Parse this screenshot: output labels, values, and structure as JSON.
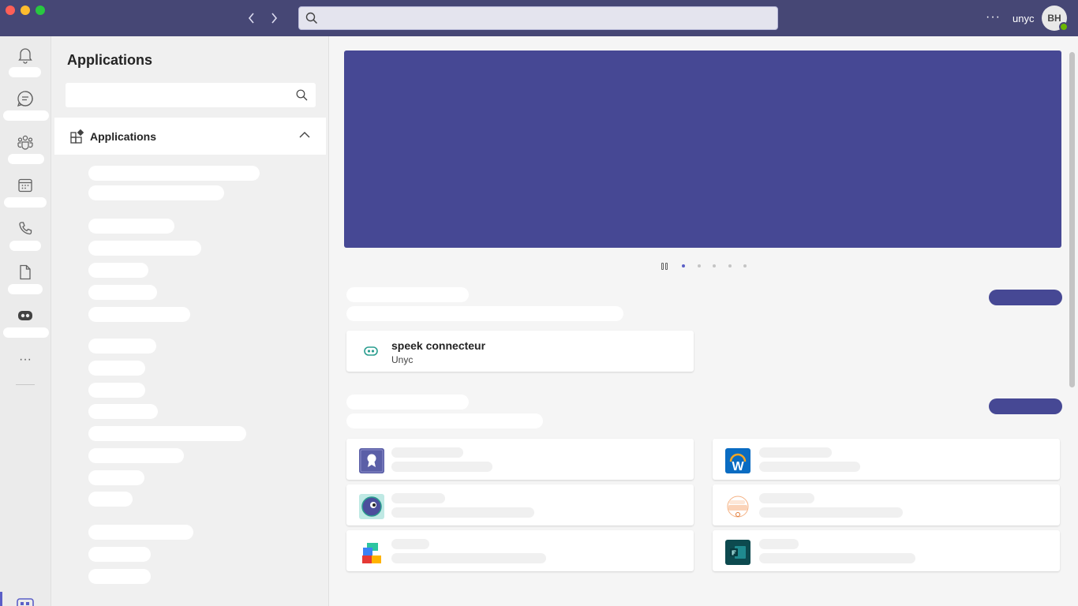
{
  "titlebar": {
    "search_placeholder": "",
    "org_name": "unyc",
    "avatar_initials": "BH",
    "more_label": "···"
  },
  "rail": {
    "items": [
      {
        "icon": "bell-icon"
      },
      {
        "icon": "chat-icon"
      },
      {
        "icon": "teams-icon"
      },
      {
        "icon": "calendar-icon"
      },
      {
        "icon": "phone-icon"
      },
      {
        "icon": "file-icon"
      },
      {
        "icon": "bot-icon"
      },
      {
        "icon": "more-icon"
      }
    ],
    "more_label": "···"
  },
  "panel": {
    "title": "Applications",
    "search_placeholder": "",
    "section_label": "Applications"
  },
  "main": {
    "carousel_total": 5,
    "carousel_active": 1,
    "featured_app": {
      "name": "speek connecteur",
      "publisher": "Unyc"
    },
    "app_logos": [
      "ribbon-logo",
      "w-logo",
      "bot-face-logo",
      "suite-prog-logo",
      "blocks-logo",
      "forms-logo"
    ]
  },
  "colors": {
    "accent": "#464775",
    "hero": "#464894",
    "active": "#5b5fc7"
  }
}
